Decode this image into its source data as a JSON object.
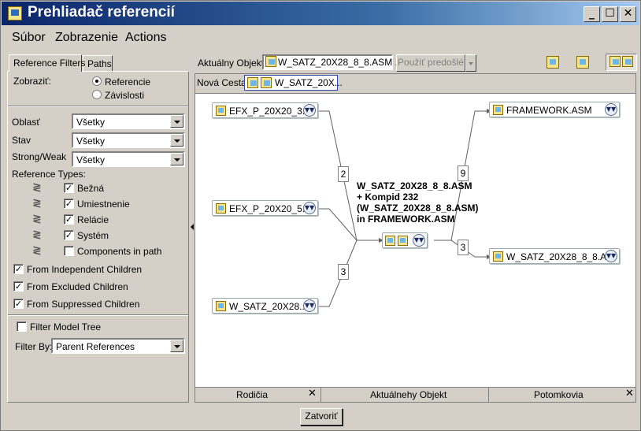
{
  "window": {
    "title": "Prehliadač referencií",
    "min_label": "_",
    "max_label": "☐",
    "close_label": "✕"
  },
  "menu": [
    "Súbor",
    "Zobrazenie",
    "Actions"
  ],
  "tabs": [
    "Reference Filters",
    "Paths"
  ],
  "filters": {
    "zobrazit_label": "Zobraziť:",
    "radio_referencie": "Referencie",
    "radio_zavislosti": "Závislosti",
    "oblast_label": "Oblasť",
    "oblast_value": "Všetky",
    "stav_label": "Stav",
    "stav_value": "Všetky",
    "strongweak_label": "Strong/Weak",
    "strongweak_value": "Všetky",
    "ref_types_label": "Reference Types:",
    "ref_types": [
      {
        "label": "Bežná",
        "checked": true
      },
      {
        "label": "Umiestnenie",
        "checked": true
      },
      {
        "label": "Relácie",
        "checked": true
      },
      {
        "label": "Systém",
        "checked": true
      },
      {
        "label": "Components in path",
        "checked": false
      }
    ],
    "from_independent": "From Independent Children",
    "from_excluded": "From Excluded Children",
    "from_suppressed": "From Suppressed Children",
    "filter_model_tree": "Filter Model Tree",
    "filter_by_label": "Filter By:",
    "filter_by_value": "Parent References"
  },
  "toolbar": {
    "current_object_label": "Aktuálny Objekt:",
    "current_object_value": "W_SATZ_20X28_8_8.ASM ...",
    "use_previous_label": "Použiť predošlé"
  },
  "path": {
    "label": "Nová Cesta:",
    "value": "W_SATZ_20X..."
  },
  "graph": {
    "parents": [
      "EFX_P_20X20_3....",
      "EFX_P_20X20_5....",
      "W_SATZ_20X28...."
    ],
    "parent_counts": [
      "2",
      "3"
    ],
    "center_label": "W_SATZ_20X28_8_8.ASM + Kompid 232 (W_SATZ_20X28_8_8.ASM) in FRAMEWORK.ASM",
    "children": [
      "FRAMEWORK.ASM",
      "W_SATZ_20X28_8_8.A..."
    ],
    "child_counts": [
      "9",
      "3"
    ]
  },
  "bottom": {
    "rodicia": "Rodičia",
    "aktualny": "Aktuálnehy Objekt",
    "potomkovia": "Potomkovia",
    "close": "✕"
  },
  "close_button": "Zatvoriť"
}
